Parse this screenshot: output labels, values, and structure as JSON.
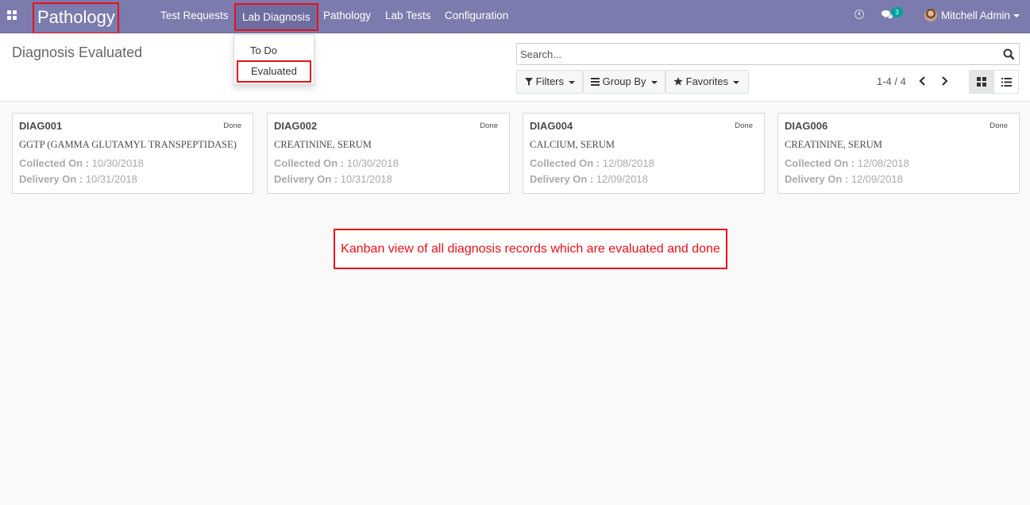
{
  "navbar": {
    "brand": "Pathology",
    "menu": [
      "Test Requests",
      "Lab Diagnosis",
      "Pathology",
      "Lab Tests",
      "Configuration"
    ],
    "messages_count": "3",
    "user_name": "Mitchell Admin"
  },
  "dropdown": {
    "items": [
      "To Do",
      "Evaluated"
    ]
  },
  "control_panel": {
    "title": "Diagnosis Evaluated",
    "search_placeholder": "Search...",
    "filters_label": "Filters",
    "group_by_label": "Group By",
    "favorites_label": "Favorites",
    "pager": "1-4 / 4"
  },
  "cards": [
    {
      "ref": "DIAG001",
      "state": "Done",
      "test": "GGTP (GAMMA GLUTAMYL TRANSPEPTIDASE)",
      "collected_label": "Collected On :",
      "collected": "10/30/2018",
      "delivery_label": "Delivery On :",
      "delivery": "10/31/2018"
    },
    {
      "ref": "DIAG002",
      "state": "Done",
      "test": "CREATININE, SERUM",
      "collected_label": "Collected On :",
      "collected": "10/30/2018",
      "delivery_label": "Delivery On :",
      "delivery": "10/31/2018"
    },
    {
      "ref": "DIAG004",
      "state": "Done",
      "test": "CALCIUM, SERUM",
      "collected_label": "Collected On :",
      "collected": "12/08/2018",
      "delivery_label": "Delivery On :",
      "delivery": "12/09/2018"
    },
    {
      "ref": "DIAG006",
      "state": "Done",
      "test": "CREATININE, SERUM",
      "collected_label": "Collected On :",
      "collected": "12/08/2018",
      "delivery_label": "Delivery On :",
      "delivery": "12/09/2018"
    }
  ],
  "annotation": "Kanban view of all diagnosis records which are evaluated and done",
  "colors": {
    "navbar": "#7c7bad",
    "highlight": "#e8101a",
    "badge": "#00a09d"
  }
}
